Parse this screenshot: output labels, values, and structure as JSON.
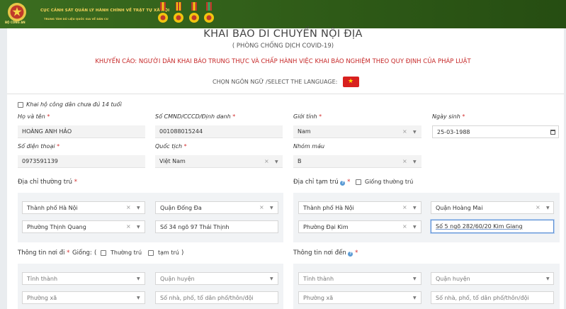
{
  "banner": {
    "line1": "CỤC CẢNH SÁT QUẢN LÝ HÀNH CHÍNH VỀ TRẬT TỰ XÃ HỘI",
    "line2": "TRUNG TÂM DỮ LIỆU QUỐC GIA VỀ DÂN CƯ",
    "logo_caption": "BỘ CÔNG AN"
  },
  "header": {
    "title": "KHAI BÁO DI CHUYỂN NỘI ĐỊA",
    "subtitle": "( PHÒNG CHỐNG DỊCH COVID-19)",
    "warning": "KHUYẾN CÁO: NGƯỜI DÂN KHAI BÁO TRUNG THỰC VÀ CHẤP HÀNH VIỆC KHAI BÁO NGHIỆM THEO QUY ĐỊNH CỦA PHÁP LUẬT",
    "language_label": "CHỌN NGÔN NGỮ /SELECT THE LANGUAGE:",
    "flag_symbol": "★"
  },
  "form": {
    "proxy_label": "Khai hộ công dân chưa đủ 14 tuổi",
    "name": {
      "label": "Họ và tên",
      "value": "HOÀNG ANH HẢO"
    },
    "id_number": {
      "label": "Số CMND/CCCD/Định danh",
      "value": "001088015244"
    },
    "gender": {
      "label": "Giới tính",
      "value": "Nam"
    },
    "dob": {
      "label": "Ngày sinh",
      "value": "25-03-1988"
    },
    "phone": {
      "label": "Số điện thoại",
      "value": "0973591139"
    },
    "nationality": {
      "label": "Quốc tịch",
      "value": "Việt Nam"
    },
    "blood": {
      "label": "Nhóm máu",
      "value": "B"
    },
    "permanent": {
      "label": "Địa chỉ thường trú",
      "province": "Thành phố Hà Nội",
      "district": "Quận Đống Đa",
      "ward": "Phường Thịnh Quang",
      "street": "Số 34 ngõ 97 Thái Thịnh"
    },
    "temporary": {
      "label": "Địa chỉ tạm trú",
      "same_label": "Giống thường trú",
      "province": "Thành phố Hà Nội",
      "district": "Quận Hoàng Mai",
      "ward": "Phường Đại Kim",
      "street": "Số 5 ngõ 282/60/20 Kim Giang"
    },
    "departure": {
      "label": "Thông tin nơi đi",
      "same_prefix": "Giống:",
      "paren_open": "(",
      "paren_close": ")",
      "opt_permanent": "Thường trú",
      "opt_temporary": "tạm trú",
      "province_ph": "Tỉnh thành",
      "district_ph": "Quận huyện",
      "ward_ph": "Phường xã",
      "street_ph": "Số nhà, phố, tổ dân phố/thôn/đội"
    },
    "arrival": {
      "label": "Thông tin nơi đến",
      "province_ph": "Tỉnh thành",
      "district_ph": "Quận huyện",
      "ward_ph": "Phường xã",
      "street_ph": "Số nhà, phố, tổ dân phố/thôn/đội"
    },
    "required_mark": "*",
    "clear_icon": "×",
    "dropdown_icon": "▼",
    "info_icon": "?"
  },
  "colors": {
    "banner": "#2e5a17",
    "banner_text": "#f2d25a",
    "warning": "#c62828",
    "required": "#d32f2f",
    "flag_red": "#d8211f",
    "flag_star": "#ffde00"
  }
}
